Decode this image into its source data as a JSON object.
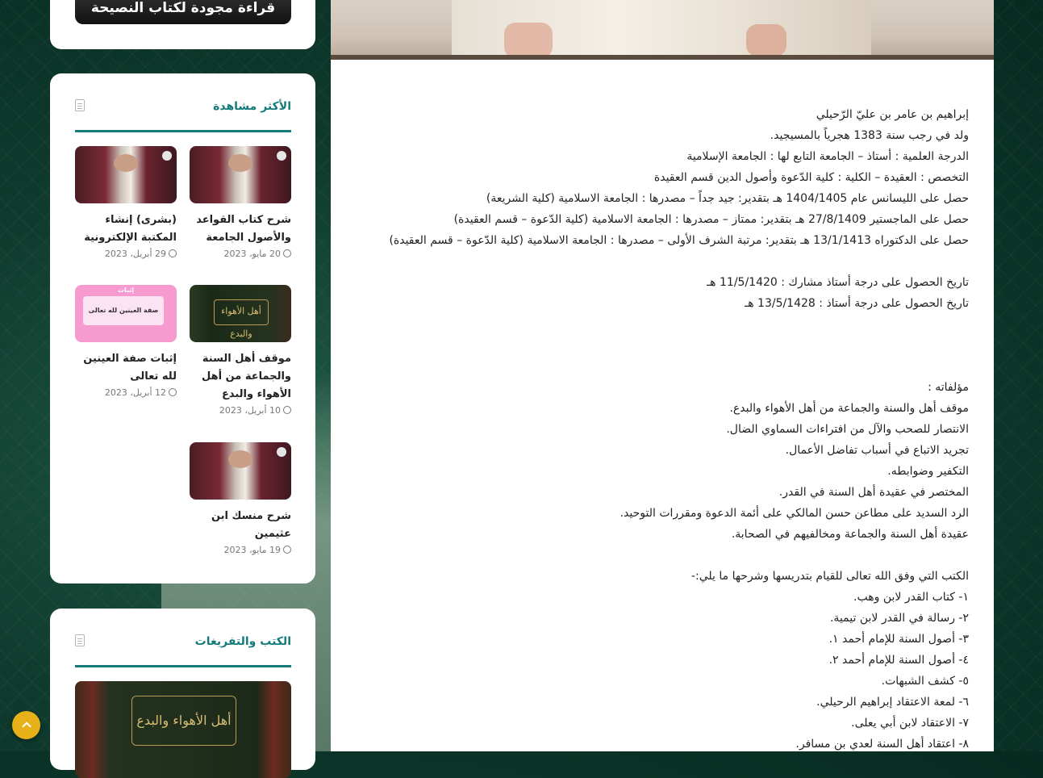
{
  "sidebar": {
    "banner_text": "قراءة مجودة لكتاب النصيحة",
    "most_viewed": {
      "title": "الأكثر مشاهدة",
      "posts": [
        {
          "title": "شرح كتاب القواعد والأصول الجامعة",
          "date": "20 مايو، 2023"
        },
        {
          "title": "(بشرى) إنشاء المكتبة الإلكترونية",
          "date": "29 أبريل، 2023"
        },
        {
          "title": "موقف أهل السنة والجماعة من أهل الأهواء والبدع",
          "date": "10 أبريل، 2023",
          "cover": "أهل الأهواء والبدع"
        },
        {
          "title": "إثبات صفة العينين لله تعالى",
          "date": "12 أبريل، 2023",
          "cover_top": "إثبات",
          "cover": "صفة العينين لله تعالى"
        },
        {
          "title": "شرح منسك ابن عثيمين",
          "date": "19 مايو، 2023"
        }
      ]
    },
    "books": {
      "title": "الكتب والتفريغات",
      "cover_text": "أهل الأهواء والبدع"
    }
  },
  "article": {
    "lines": [
      "إبراهيم بن عامر بن عليّ الرّحيلي",
      "ولد في رجب سنة 1383 هجرياً بالمسيجيد.",
      "الدرجة العلمية : أستاذ – الجامعة التابع لها : الجامعة الإسلامية",
      "التخصص : العقيدة – الكلية : كلية الدّعوة وأصول الدين قسم العقيدة",
      "حصل على الليسانس عام 1404/1405 هـ بتقدير: جيد جداً – مصدرها : الجامعة الاسلامية (كلية الشريعة)",
      "حصل على الماجستير 27/8/1409 هـ بتقدير: ممتاز – مصدرها : الجامعة الاسلامية (كلية الدّعوة – قسم العقيدة)",
      "حصل على الدكتوراه 13/1/1413 هـ بتقدير: مرتبة الشرف الأولى – مصدرها : الجامعة الاسلامية (كلية الدّعوة – قسم العقيدة)",
      "",
      "تاريخ الحصول على درجة أستاذ مشارك : 11/5/1420 هـ",
      "تاريخ الحصول على درجة أستاذ : 13/5/1428 هـ",
      "",
      "",
      "",
      "مؤلفاته :",
      "موقف أهل والسنة والجماعة من أهل الأهواء والبدع.",
      "الانتصار للصحب والآل من افتراءات السماوي الضال.",
      "تجريد الاتباع في أسباب تفاضل الأعمال.",
      "التكفير وضوابطه.",
      "المختصر في عقيدة أهل السنة في القدر.",
      "الرد السديد على مطاعن حسن المالكي على أئمة الدعوة ومقررات التوحيد.",
      "عقيدة أهل السنة والجماعة ومخالفيهم في الصحابة.",
      "",
      "الكتب التي وفق الله تعالى للقيام بتدريسها وشرحها ما يلي:-",
      "١- كتاب القدر لابن وهب.",
      "٢- رسالة في القدر لابن تيمية.",
      "٣- أصول السنة للإمام أحمد ١.",
      "٤- أصول السنة للإمام أحمد ٢.",
      "٥- كشف الشبهات.",
      "٦- لمعة الاعتقاد إبراهيم الرحيلي.",
      "٧- الاعتقاد لابن أبي يعلى.",
      "٨- اعتقاد أهل السنة لعدي بن مسافر."
    ]
  },
  "colors": {
    "accent": "#157a7a",
    "scroll_button": "#e7b219",
    "background": "#0f3b2e"
  }
}
